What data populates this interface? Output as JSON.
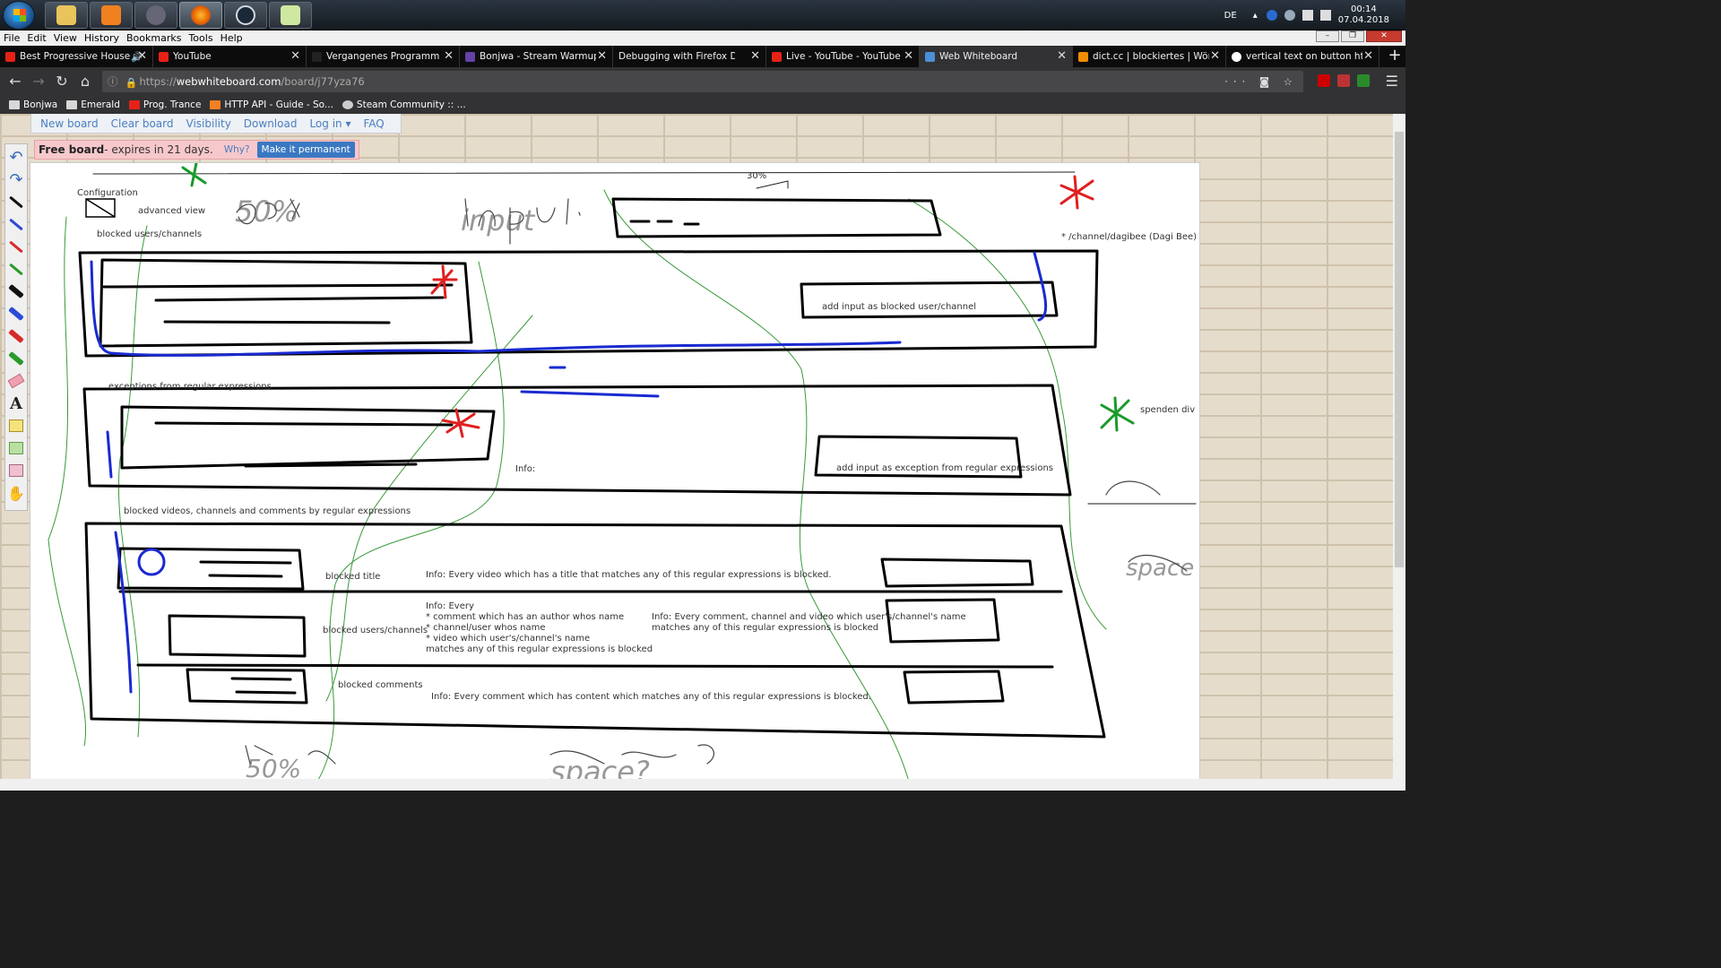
{
  "taskbar": {
    "language": "DE",
    "time": "00:14",
    "date": "07.04.2018"
  },
  "menubar": {
    "items": [
      "File",
      "Edit",
      "View",
      "History",
      "Bookmarks",
      "Tools",
      "Help"
    ]
  },
  "tabs": [
    {
      "label": "Best Progressive House",
      "icon": "youtube-icon",
      "color": "#e62117"
    },
    {
      "label": "YouTube",
      "icon": "youtube-icon",
      "color": "#e62117"
    },
    {
      "label": "Vergangenes Programm | B",
      "icon": "page-icon",
      "color": "#222222"
    },
    {
      "label": "Bonjwa - Stream Warmup n",
      "icon": "twitch-icon",
      "color": "#6441a4"
    },
    {
      "label": "Debugging with Firefox Develop",
      "icon": "none",
      "color": "#0c0c0d"
    },
    {
      "label": "Live - YouTube - YouTube",
      "icon": "youtube-icon",
      "color": "#e62117"
    },
    {
      "label": "Web Whiteboard",
      "icon": "whiteboard-icon",
      "color": "#4a90d9"
    },
    {
      "label": "dict.cc | blockiertes | Wörterb",
      "icon": "dictcc-icon",
      "color": "#f08c00"
    },
    {
      "label": "vertical text on button html",
      "icon": "google-icon",
      "color": "#ffffff"
    }
  ],
  "navbar": {
    "url_prefix": "https://",
    "url_host": "webwhiteboard.com",
    "url_path": "/board/j77yza76"
  },
  "bookmarks": [
    {
      "label": "Bonjwa",
      "icon": "folder-icon"
    },
    {
      "label": "Emerald",
      "icon": "folder-icon"
    },
    {
      "label": "Prog. Trance",
      "icon": "youtube-icon"
    },
    {
      "label": "HTTP API - Guide - So...",
      "icon": "stackoverflow-icon"
    },
    {
      "label": "Steam Community :: ...",
      "icon": "steam-icon"
    }
  ],
  "site_menu": {
    "items": [
      "New board",
      "Clear board",
      "Visibility",
      "Download",
      "Log in ▾",
      "FAQ"
    ]
  },
  "free_bar": {
    "strong": "Free board",
    "text": " - expires in 21 days.",
    "why": "Why?",
    "button": "Make it permanent"
  },
  "board_texts": {
    "percent_top": "30%",
    "configuration": "Configuration",
    "advanced_view": "advanced view",
    "blocked_users_channels": "blocked users/channels",
    "channel_note": "* /channel/dagibee (Dagi Bee)",
    "add_input_blocked": "add input as blocked user/channel",
    "exceptions": "exceptions from regular expressions",
    "spenden": "spenden div",
    "info_short": "Info:",
    "add_input_exception": "add input as exception from regular expressions",
    "blocked_videos": "blocked videos, channels and comments by regular expressions",
    "blocked_title": "blocked title",
    "info_title": "Info: Every video which has a title that matches any of this regular expressions is blocked.",
    "info_every": "Info: Every",
    "info_line1": "* comment which has an author whos name",
    "info_line2": "* channel/user whos name",
    "info_line3": "* video which user's/channel's name",
    "info_line4": "matches any of this regular expressions is blocked",
    "blocked_users_channels_2": "blocked users/channels",
    "info_comment_channel_1": "Info: Every comment, channel and video which user's/channel's name",
    "info_comment_channel_2": "matches any of this regular expressions is blocked",
    "blocked_comments": "blocked comments",
    "info_comments": "Info: Every comment which has content which matches any of this regular expressions is blocked."
  },
  "handwriting": {
    "fifty": "50%",
    "input": "input",
    "space_right": "space",
    "space_bottom": "space?",
    "fifty_bottom": "50%"
  }
}
